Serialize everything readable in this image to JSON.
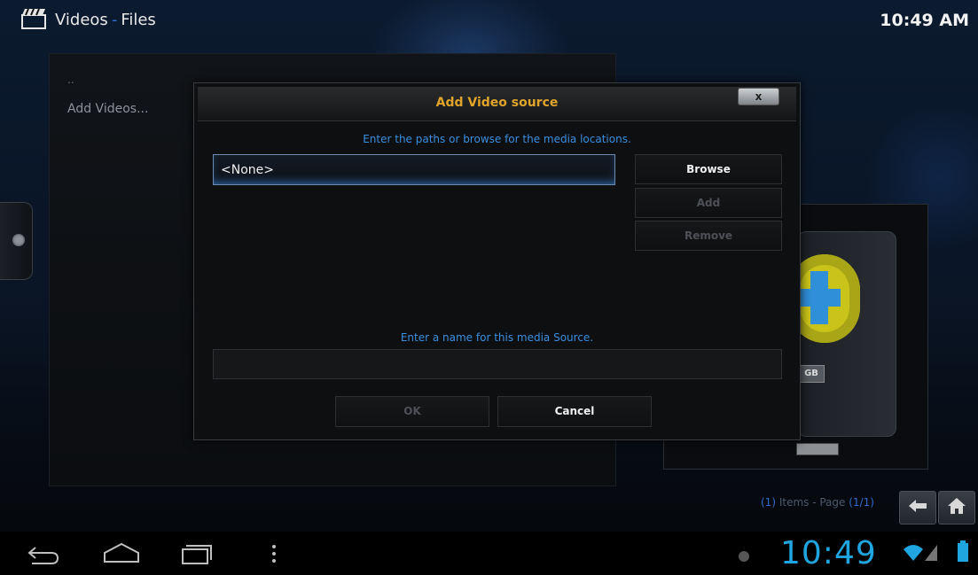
{
  "header": {
    "section": "Videos",
    "separator": "-",
    "subsection": "Files",
    "clock": "10:49 AM"
  },
  "file_list": {
    "parent_item": "..",
    "items": [
      "Add Videos..."
    ]
  },
  "media_panel": {
    "drive_label": "GB"
  },
  "dialog": {
    "title": "Add Video source",
    "close_label": "x",
    "paths_hint": "Enter the paths or browse for the media locations.",
    "path_value": "<None>",
    "browse_label": "Browse",
    "add_label": "Add",
    "remove_label": "Remove",
    "name_hint": "Enter a name for this media Source.",
    "name_value": "",
    "ok_label": "OK",
    "cancel_label": "Cancel"
  },
  "footer": {
    "items_count": "(1)",
    "items_text": "Items - Page",
    "page": "(1/1)"
  },
  "system_bar": {
    "clock": "10:49",
    "accent_color": "#1fa5e0"
  },
  "colors": {
    "dialog_title": "#e0a42a",
    "hint_text": "#3a8fe0",
    "crumb_separator": "#2f6bd1"
  },
  "icons": [
    "clapperboard-icon",
    "back-icon",
    "home-icon",
    "android-back-icon",
    "android-home-icon",
    "android-recents-icon",
    "android-menu-icon",
    "notification-icon",
    "wifi-icon",
    "signal-icon",
    "battery-icon"
  ]
}
